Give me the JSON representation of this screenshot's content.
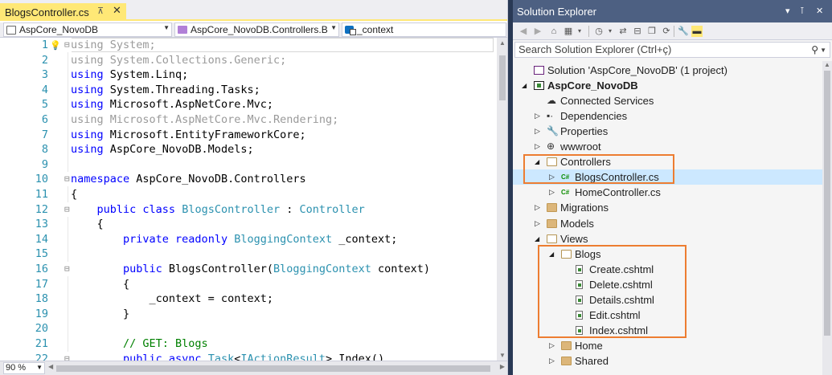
{
  "editor": {
    "tab": {
      "label": "BlogsController.cs",
      "pin_glyph": "⊼",
      "close_glyph": "✕"
    },
    "nav": {
      "project": "AspCore_NovoDB",
      "class": "AspCore_NovoDB.Controllers.B",
      "member": "_context"
    },
    "zoom": "90 %",
    "lines": [
      {
        "n": "1",
        "tokens": [
          {
            "t": "using",
            "c": "dim"
          },
          {
            "t": " System;",
            "c": "dim"
          }
        ]
      },
      {
        "n": "2",
        "tokens": [
          {
            "t": "using",
            "c": "dim"
          },
          {
            "t": " System.Collections.Generic;",
            "c": "dim"
          }
        ]
      },
      {
        "n": "3",
        "tokens": [
          {
            "t": "using",
            "c": "kw"
          },
          {
            "t": " System.Linq;",
            "c": "tx"
          }
        ]
      },
      {
        "n": "4",
        "tokens": [
          {
            "t": "using",
            "c": "kw"
          },
          {
            "t": " System.Threading.Tasks;",
            "c": "tx"
          }
        ]
      },
      {
        "n": "5",
        "tokens": [
          {
            "t": "using",
            "c": "kw"
          },
          {
            "t": " Microsoft.AspNetCore.Mvc;",
            "c": "tx"
          }
        ]
      },
      {
        "n": "6",
        "tokens": [
          {
            "t": "using",
            "c": "dim"
          },
          {
            "t": " Microsoft.AspNetCore.Mvc.Rendering;",
            "c": "dim"
          }
        ]
      },
      {
        "n": "7",
        "tokens": [
          {
            "t": "using",
            "c": "kw"
          },
          {
            "t": " Microsoft.EntityFrameworkCore;",
            "c": "tx"
          }
        ]
      },
      {
        "n": "8",
        "tokens": [
          {
            "t": "using",
            "c": "kw"
          },
          {
            "t": " AspCore_NovoDB.Models;",
            "c": "tx"
          }
        ]
      },
      {
        "n": "9",
        "tokens": []
      },
      {
        "n": "10",
        "tokens": [
          {
            "t": "namespace",
            "c": "kw"
          },
          {
            "t": " AspCore_NovoDB.Controllers",
            "c": "tx"
          }
        ]
      },
      {
        "n": "11",
        "tokens": [
          {
            "t": "{",
            "c": "tx"
          }
        ]
      },
      {
        "n": "12",
        "tokens": [
          {
            "t": "    public",
            "c": "kw"
          },
          {
            "t": " class",
            "c": "kw"
          },
          {
            "t": " BlogsController",
            "c": "ty"
          },
          {
            "t": " : ",
            "c": "tx"
          },
          {
            "t": "Controller",
            "c": "ty"
          }
        ]
      },
      {
        "n": "13",
        "tokens": [
          {
            "t": "    {",
            "c": "tx"
          }
        ]
      },
      {
        "n": "14",
        "tokens": [
          {
            "t": "        private",
            "c": "kw"
          },
          {
            "t": " readonly",
            "c": "kw"
          },
          {
            "t": " BloggingContext",
            "c": "ty"
          },
          {
            "t": " _context;",
            "c": "tx"
          }
        ]
      },
      {
        "n": "15",
        "tokens": []
      },
      {
        "n": "16",
        "tokens": [
          {
            "t": "        public",
            "c": "kw"
          },
          {
            "t": " BlogsController(",
            "c": "tx"
          },
          {
            "t": "BloggingContext",
            "c": "ty"
          },
          {
            "t": " context)",
            "c": "tx"
          }
        ]
      },
      {
        "n": "17",
        "tokens": [
          {
            "t": "        {",
            "c": "tx"
          }
        ]
      },
      {
        "n": "18",
        "tokens": [
          {
            "t": "            _context = context;",
            "c": "tx"
          }
        ]
      },
      {
        "n": "19",
        "tokens": [
          {
            "t": "        }",
            "c": "tx"
          }
        ]
      },
      {
        "n": "20",
        "tokens": []
      },
      {
        "n": "21",
        "tokens": [
          {
            "t": "        // GET: Blogs",
            "c": "cm"
          }
        ]
      },
      {
        "n": "22",
        "tokens": [
          {
            "t": "        public",
            "c": "kw"
          },
          {
            "t": " async",
            "c": "kw"
          },
          {
            "t": " Task",
            "c": "ty"
          },
          {
            "t": "<",
            "c": "tx"
          },
          {
            "t": "IActionResult",
            "c": "ty"
          },
          {
            "t": "> Index()",
            "c": "tx"
          }
        ]
      }
    ],
    "fold_lines": [
      "1",
      "10",
      "12",
      "16",
      "22"
    ]
  },
  "solution_explorer": {
    "title": "Solution Explorer",
    "title_buttons": {
      "dropdown": "▾",
      "pin": "⊺",
      "close": "✕"
    },
    "search_placeholder": "Search Solution Explorer (Ctrl+ç)",
    "tree": [
      {
        "id": "solution",
        "label": "Solution 'AspCore_NovoDB' (1 project)",
        "level": 0,
        "icon": "solution-icon",
        "expander": ""
      },
      {
        "id": "project",
        "label": "AspCore_NovoDB",
        "level": 0,
        "icon": "project-icon",
        "expander": "expanded",
        "bold": true
      },
      {
        "id": "connected-services",
        "label": "Connected Services",
        "level": 1,
        "icon": "cloud-icon",
        "expander": ""
      },
      {
        "id": "dependencies",
        "label": "Dependencies",
        "level": 1,
        "icon": "dependencies-icon",
        "expander": "collapsed"
      },
      {
        "id": "properties",
        "label": "Properties",
        "level": 1,
        "icon": "wrench-icon",
        "expander": "collapsed"
      },
      {
        "id": "wwwroot",
        "label": "wwwroot",
        "level": 1,
        "icon": "globe-icon",
        "expander": "collapsed"
      },
      {
        "id": "controllers",
        "label": "Controllers",
        "level": 1,
        "icon": "folder-open-icon",
        "expander": "expanded"
      },
      {
        "id": "blogs-controller",
        "label": "BlogsController.cs",
        "level": 2,
        "icon": "csharp-file-icon",
        "expander": "collapsed",
        "selected": true
      },
      {
        "id": "home-controller",
        "label": "HomeController.cs",
        "level": 2,
        "icon": "csharp-file-icon",
        "expander": "collapsed"
      },
      {
        "id": "migrations",
        "label": "Migrations",
        "level": 1,
        "icon": "folder-icon",
        "expander": "collapsed"
      },
      {
        "id": "models",
        "label": "Models",
        "level": 1,
        "icon": "folder-icon",
        "expander": "collapsed"
      },
      {
        "id": "views",
        "label": "Views",
        "level": 1,
        "icon": "folder-open-icon",
        "expander": "expanded"
      },
      {
        "id": "blogs",
        "label": "Blogs",
        "level": 2,
        "icon": "folder-open-icon",
        "expander": "expanded"
      },
      {
        "id": "create",
        "label": "Create.cshtml",
        "level": 3,
        "icon": "razor-file-icon",
        "expander": ""
      },
      {
        "id": "delete",
        "label": "Delete.cshtml",
        "level": 3,
        "icon": "razor-file-icon",
        "expander": ""
      },
      {
        "id": "details",
        "label": "Details.cshtml",
        "level": 3,
        "icon": "razor-file-icon",
        "expander": ""
      },
      {
        "id": "edit",
        "label": "Edit.cshtml",
        "level": 3,
        "icon": "razor-file-icon",
        "expander": ""
      },
      {
        "id": "index",
        "label": "Index.cshtml",
        "level": 3,
        "icon": "razor-file-icon",
        "expander": ""
      },
      {
        "id": "home",
        "label": "Home",
        "level": 2,
        "icon": "folder-icon",
        "expander": "collapsed"
      },
      {
        "id": "shared",
        "label": "Shared",
        "level": 2,
        "icon": "folder-icon",
        "expander": "collapsed"
      }
    ]
  },
  "colors": {
    "highlight_box": "#ed7d31",
    "selection": "#cce8ff",
    "titlebar": "#4d6082",
    "active_tab": "#ffe876"
  }
}
